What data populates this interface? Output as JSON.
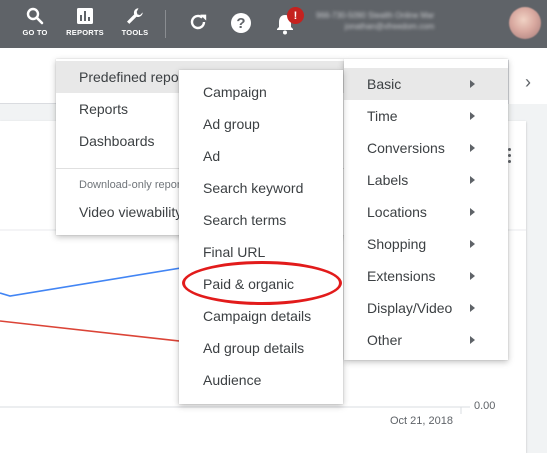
{
  "toolbar": {
    "goto_label": "GO TO",
    "reports_label": "REPORTS",
    "tools_label": "TOOLS",
    "refresh_icon": "refresh-icon",
    "help_icon": "help-icon",
    "notifications_icon": "bell-icon",
    "notification_badge": "!",
    "account_line1": "966-730-5090 Stealth Online Mar",
    "account_line2": "jonathan@xfreedom.com"
  },
  "page": {
    "axis_value": "0.00",
    "date_label": "Oct 21, 2018"
  },
  "menu_reports": {
    "items": [
      "Predefined reports",
      "Reports",
      "Dashboards"
    ],
    "section_label": "Download-only reports",
    "section_items": [
      "Video viewability"
    ]
  },
  "menu_predefined": {
    "items": [
      "Campaign",
      "Ad group",
      "Ad",
      "Search keyword",
      "Search terms",
      "Final URL",
      "Paid & organic",
      "Campaign details",
      "Ad group details",
      "Audience"
    ]
  },
  "menu_basic": {
    "items": [
      "Basic",
      "Time",
      "Conversions",
      "Labels",
      "Locations",
      "Shopping",
      "Extensions",
      "Display/Video",
      "Other"
    ]
  },
  "colors": {
    "toolbar": "#5f6368",
    "line_blue": "#4285f4",
    "line_red": "#db4437",
    "annotation": "#e21b1b"
  }
}
